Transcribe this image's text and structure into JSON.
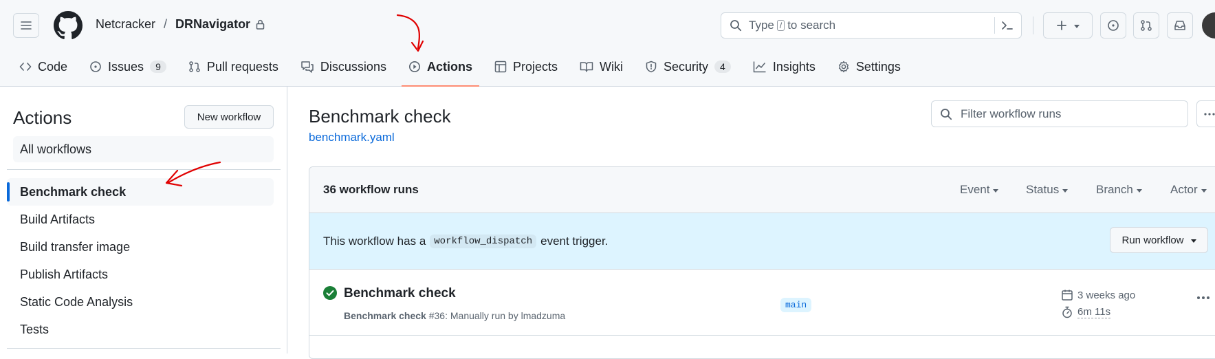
{
  "header": {
    "owner": "Netcracker",
    "separator": "/",
    "repo": "DRNavigator",
    "search_placeholder_pre": "Type",
    "search_key": "/",
    "search_placeholder_post": "to search"
  },
  "tabs": [
    {
      "label": "Code",
      "icon": "code-icon"
    },
    {
      "label": "Issues",
      "icon": "issue-icon",
      "count": "9"
    },
    {
      "label": "Pull requests",
      "icon": "pull-request-icon"
    },
    {
      "label": "Discussions",
      "icon": "discussion-icon"
    },
    {
      "label": "Actions",
      "icon": "play-icon",
      "active": true
    },
    {
      "label": "Projects",
      "icon": "table-icon"
    },
    {
      "label": "Wiki",
      "icon": "book-icon"
    },
    {
      "label": "Security",
      "icon": "shield-icon",
      "count": "4"
    },
    {
      "label": "Insights",
      "icon": "graph-icon"
    },
    {
      "label": "Settings",
      "icon": "gear-icon"
    }
  ],
  "sidebar": {
    "title": "Actions",
    "new_workflow": "New workflow",
    "all_workflows": "All workflows",
    "workflows": [
      {
        "label": "Benchmark check",
        "active": true
      },
      {
        "label": "Build Artifacts"
      },
      {
        "label": "Build transfer image"
      },
      {
        "label": "Publish Artifacts"
      },
      {
        "label": "Static Code Analysis"
      },
      {
        "label": "Tests"
      }
    ]
  },
  "main": {
    "title": "Benchmark check",
    "file": "benchmark.yaml",
    "filter_placeholder": "Filter workflow runs",
    "runs_count": "36 workflow runs",
    "filters": [
      "Event",
      "Status",
      "Branch",
      "Actor"
    ],
    "dispatch_pre": "This workflow has a",
    "dispatch_code": "workflow_dispatch",
    "dispatch_post": "event trigger.",
    "run_workflow": "Run workflow",
    "run": {
      "title": "Benchmark check",
      "meta_name": "Benchmark check",
      "meta_rest": "#36: Manually run by lmadzuma",
      "branch": "main",
      "when": "3 weeks ago",
      "duration": "6m 11s",
      "status": "success"
    }
  },
  "colors": {
    "accent": "#0969da",
    "success": "#1a7f37",
    "tab_underline": "#fd8c73",
    "annotation": "#e00000"
  }
}
